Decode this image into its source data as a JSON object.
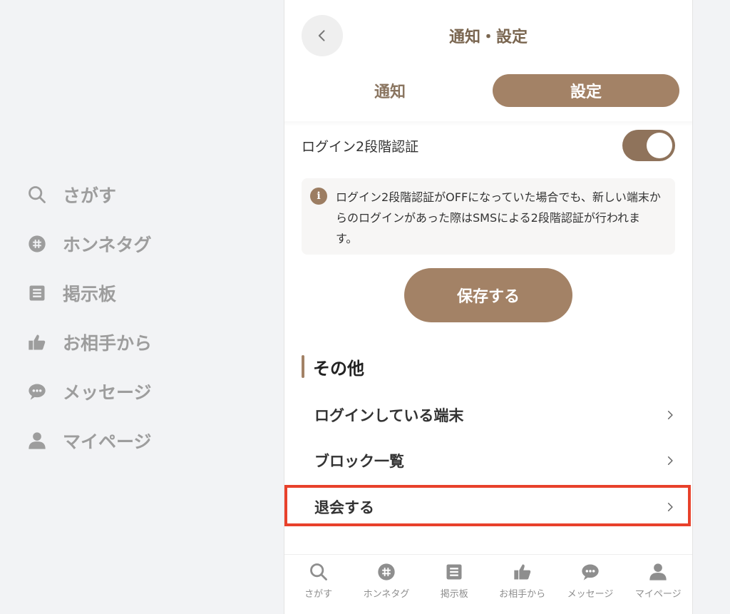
{
  "sidebar": {
    "items": [
      {
        "label": "さがす",
        "icon": "search-icon"
      },
      {
        "label": "ホンネタグ",
        "icon": "tag-icon"
      },
      {
        "label": "掲示板",
        "icon": "board-icon"
      },
      {
        "label": "お相手から",
        "icon": "thumbs-up-icon"
      },
      {
        "label": "メッセージ",
        "icon": "chat-icon"
      },
      {
        "label": "マイページ",
        "icon": "person-icon"
      }
    ]
  },
  "header": {
    "title": "通知・設定"
  },
  "tabs": {
    "notify": "通知",
    "settings": "設定",
    "active": "settings"
  },
  "settings": {
    "two_factor_label": "ログイン2段階認証",
    "two_factor_enabled": true,
    "notice_text": "ログイン2段階認証がOFFになっていた場合でも、新しい端末からのログインがあった際はSMSによる2段階認証が行われます。",
    "save_label": "保存する"
  },
  "other": {
    "heading": "その他",
    "items": [
      {
        "label": "ログインしている端末"
      },
      {
        "label": "ブロック一覧"
      },
      {
        "label": "退会する"
      }
    ]
  },
  "tabbar": {
    "items": [
      {
        "label": "さがす"
      },
      {
        "label": "ホンネタグ"
      },
      {
        "label": "掲示板"
      },
      {
        "label": "お相手から"
      },
      {
        "label": "メッセージ"
      },
      {
        "label": "マイページ"
      }
    ]
  },
  "colors": {
    "accent": "#a38266",
    "highlight": "#e8412b",
    "sidebar_text": "#9d9d9d"
  }
}
